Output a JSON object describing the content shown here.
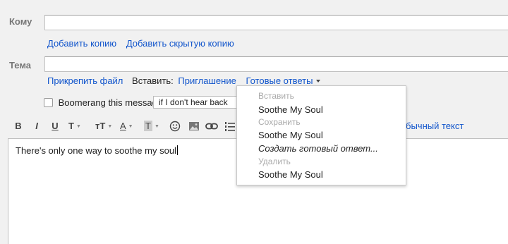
{
  "to": {
    "label": "Кому",
    "value": ""
  },
  "recipients_links": {
    "add_cc": "Добавить копию",
    "add_bcc": "Добавить скрытую копию"
  },
  "subject": {
    "label": "Тема",
    "value": ""
  },
  "attach_row": {
    "attach": "Прикрепить файл",
    "insert_label": "Вставить:",
    "invitation": "Приглашение",
    "canned": "Готовые ответы"
  },
  "boomerang": {
    "label": "Boomerang this message",
    "select_value": "if I don't hear back"
  },
  "toolbar": {
    "bold": "B",
    "italic": "I",
    "underline": "U",
    "font": "T",
    "size": "тT",
    "color": "A",
    "highlight": "T",
    "plain_text": "бычный текст"
  },
  "editor": {
    "body": "There's only one way to soothe my soul"
  },
  "canned_menu": {
    "insert_header": "Вставить",
    "insert_item": "Soothe My Soul",
    "save_header": "Сохранить",
    "save_item": "Soothe My Soul",
    "create_new": "Создать готовый ответ...",
    "delete_header": "Удалить",
    "delete_item": "Soothe My Soul"
  }
}
